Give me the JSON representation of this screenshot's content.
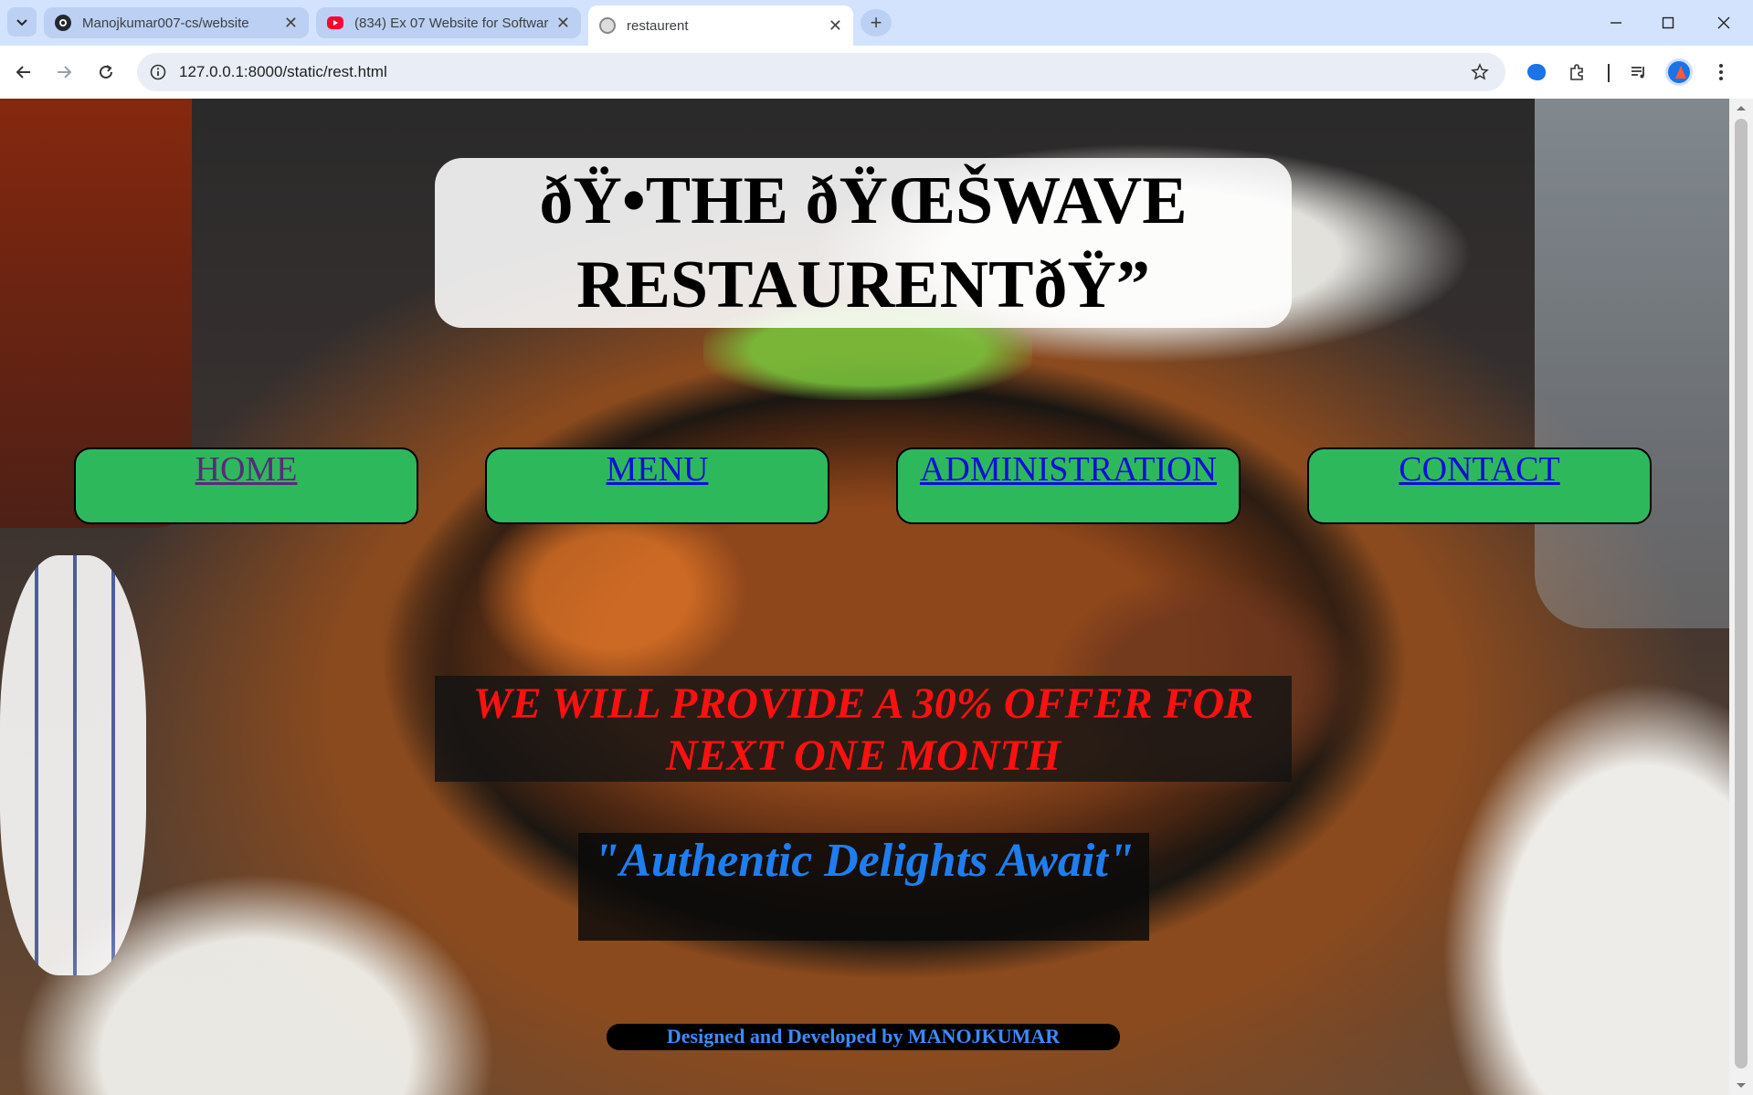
{
  "browser": {
    "tabs": [
      {
        "label": "Manojkumar007-cs/website",
        "icon": "github-icon",
        "active": false
      },
      {
        "label": "(834) Ex 07 Website for Softwar",
        "icon": "youtube-icon",
        "active": false
      },
      {
        "label": "restaurent",
        "icon": "globe-icon",
        "active": true
      }
    ],
    "url": "127.0.0.1:8000/static/rest.html"
  },
  "page": {
    "title": "ðŸ•THE ðŸŒŠWAVE RESTAURENTðŸ”",
    "nav": [
      {
        "label": "HOME"
      },
      {
        "label": "MENU"
      },
      {
        "label": "ADMINISTRATION"
      },
      {
        "label": "CONTACT"
      }
    ],
    "offer": "WE WILL PROVIDE A 30% OFFER FOR NEXT ONE MONTH",
    "quote": "\"Authentic Delights Await\"",
    "credit": "Designed and Developed by MANOJKUMAR"
  },
  "colors": {
    "nav_bg": "#2eb85c",
    "offer_text": "#ff1010",
    "quote_text": "#1e7ef0",
    "credit_text": "#3d8bff",
    "tabstrip": "#d3e3fd"
  }
}
